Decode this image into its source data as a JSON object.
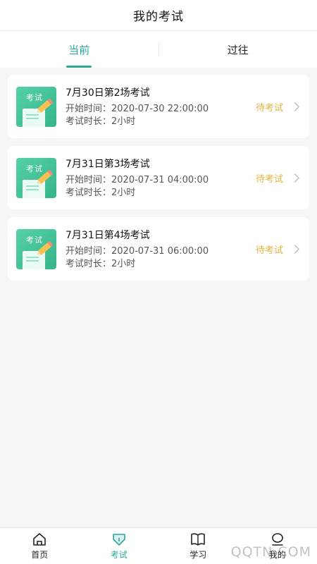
{
  "header": {
    "title": "我的考试"
  },
  "tabs": [
    {
      "label": "当前",
      "active": true
    },
    {
      "label": "过往",
      "active": false
    }
  ],
  "exams": [
    {
      "thumb_label": "考试",
      "name": "7月30日第2场考试",
      "start_label": "开始时间：",
      "start_time": "2020-07-30 22:00:00",
      "duration_label": "考试时长：",
      "duration": "2小时",
      "status": "待考试"
    },
    {
      "thumb_label": "考试",
      "name": "7月31日第3场考试",
      "start_label": "开始时间：",
      "start_time": "2020-07-31 04:00:00",
      "duration_label": "考试时长：",
      "duration": "2小时",
      "status": "待考试"
    },
    {
      "thumb_label": "考试",
      "name": "7月31日第4场考试",
      "start_label": "开始时间：",
      "start_time": "2020-07-31 06:00:00",
      "duration_label": "考试时长：",
      "duration": "2小时",
      "status": "待考试"
    }
  ],
  "bottom_nav": [
    {
      "label": "首页",
      "icon": "home-icon"
    },
    {
      "label": "考试",
      "icon": "exam-icon"
    },
    {
      "label": "学习",
      "icon": "book-icon"
    },
    {
      "label": "我的",
      "icon": "profile-icon"
    }
  ],
  "watermark": "QQTN.COM",
  "colors": {
    "accent": "#2aa89a",
    "status": "#e3b23f"
  }
}
